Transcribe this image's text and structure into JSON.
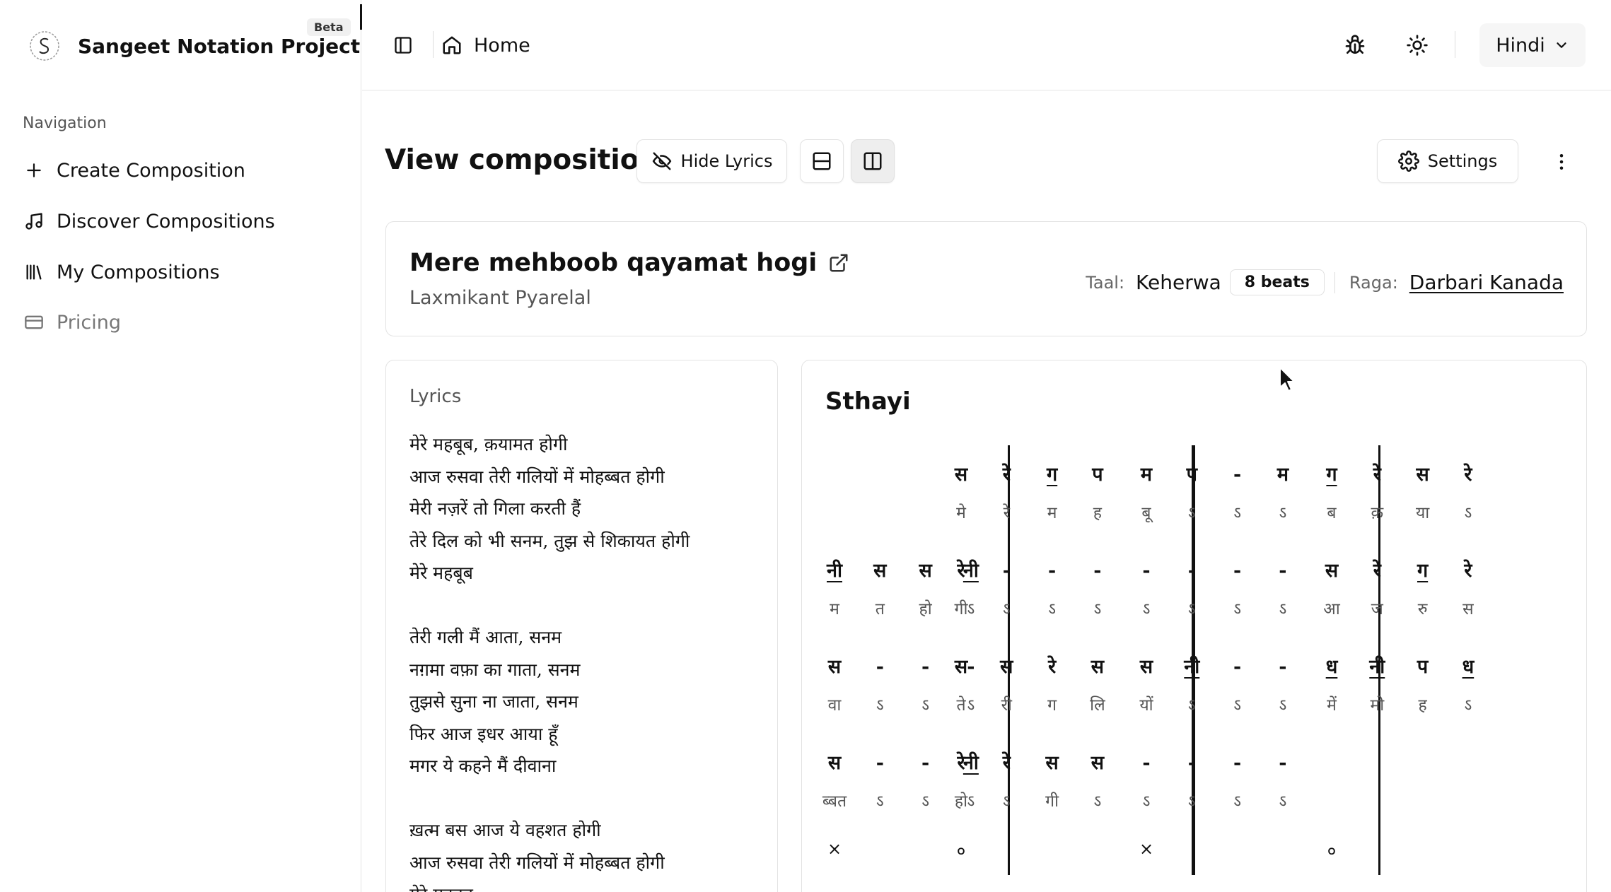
{
  "sidebar": {
    "brand": "Sangeet Notation Project",
    "badge": "Beta",
    "nav_heading": "Navigation",
    "items": [
      {
        "label": "Create Composition",
        "icon": "plus-icon"
      },
      {
        "label": "Discover Compositions",
        "icon": "music-note-icon"
      },
      {
        "label": "My Compositions",
        "icon": "library-icon"
      },
      {
        "label": "Pricing",
        "icon": "credit-card-icon"
      }
    ]
  },
  "header": {
    "breadcrumb_home": "Home",
    "language": "Hindi"
  },
  "toolbar": {
    "title": "View composition",
    "hide_lyrics": "Hide Lyrics",
    "settings": "Settings"
  },
  "composition": {
    "title": "Mere mehboob qayamat hogi",
    "composer": "Laxmikant Pyarelal",
    "taal_label": "Taal:",
    "taal": "Keherwa",
    "beats": "8 beats",
    "raga_label": "Raga:",
    "raga": "Darbari Kanada"
  },
  "lyrics": {
    "heading": "Lyrics",
    "lines": [
      "मेरे महबूब, क़यामत होगी",
      "आज रुसवा तेरी गलियों में मोहब्बत होगी",
      "मेरी नज़रें तो गिला करती हैं",
      "तेरे दिल को भी सनम, तुझ से शिकायत होगी",
      "मेरे महबूब",
      "",
      "तेरी गली मैं आता, सनम",
      "नग़मा वफ़ा का गाता, सनम",
      "तुझसे सुना ना जाता, सनम",
      "फिर आज इधर आया हूँ",
      "मगर ये कहने मैं दीवाना",
      "",
      "ख़त्म बस आज ये वहशत होगी",
      "आज रुसवा तेरी गलियों में मोहब्बत होगी",
      "मेरे महबूब"
    ]
  },
  "notation": {
    "section": "Sthayi",
    "rows": [
      {
        "swaras": [
          "",
          "",
          "",
          "",
          "स",
          "रे",
          "ग",
          "प",
          "म",
          "प",
          "-",
          "म",
          "ग",
          "रे",
          "स",
          "रे"
        ],
        "syllables": [
          "",
          "",
          "",
          "",
          "मे",
          "रे",
          "म",
          "ह",
          "बू",
          "ऽ",
          "ऽ",
          "ऽ",
          "ब",
          "क़",
          "या",
          "ऽ"
        ],
        "underline": [
          6,
          12
        ]
      },
      {
        "swaras": [
          "नी",
          "स",
          "स",
          "नी",
          "रे",
          "-",
          "-",
          "-",
          "-",
          "-",
          "-",
          "-",
          "स",
          "रे",
          "ग",
          "रे"
        ],
        "syllables": [
          "म",
          "त",
          "हो",
          "ऽ",
          "गी",
          "ऽ",
          "ऽ",
          "ऽ",
          "ऽ",
          "ऽ",
          "ऽ",
          "ऽ",
          "आ",
          "ज",
          "रु",
          "स"
        ],
        "underline": [
          0,
          3,
          14
        ]
      },
      {
        "swaras": [
          "स",
          "-",
          "-",
          "-",
          "स",
          "स",
          "रे",
          "स",
          "स",
          "नी",
          "-",
          "-",
          "ध",
          "नी",
          "प",
          "ध"
        ],
        "syllables": [
          "वा",
          "ऽ",
          "ऽ",
          "ऽ",
          "ते",
          "री",
          "ग",
          "लि",
          "यों",
          "ऽ",
          "ऽ",
          "ऽ",
          "में",
          "मो",
          "ह",
          "ऽ"
        ],
        "underline": [
          9,
          12,
          13,
          15
        ]
      },
      {
        "swaras": [
          "स",
          "-",
          "-",
          "नी",
          "रे",
          "रे",
          "स",
          "स",
          "-",
          "-",
          "-",
          "-",
          "",
          "",
          "",
          ""
        ],
        "syllables": [
          "ब्बत",
          "ऽ",
          "ऽ",
          "ऽ",
          "हो",
          "ऽ",
          "गी",
          "ऽ",
          "ऽ",
          "ऽ",
          "ऽ",
          "ऽ",
          "",
          "",
          "",
          ""
        ],
        "underline": [
          3
        ]
      }
    ],
    "vibhag_markers": [
      "×",
      "०",
      "×",
      "०"
    ]
  },
  "colors": {
    "text": "#111111",
    "muted": "#555555",
    "border": "#e3e3e3"
  }
}
